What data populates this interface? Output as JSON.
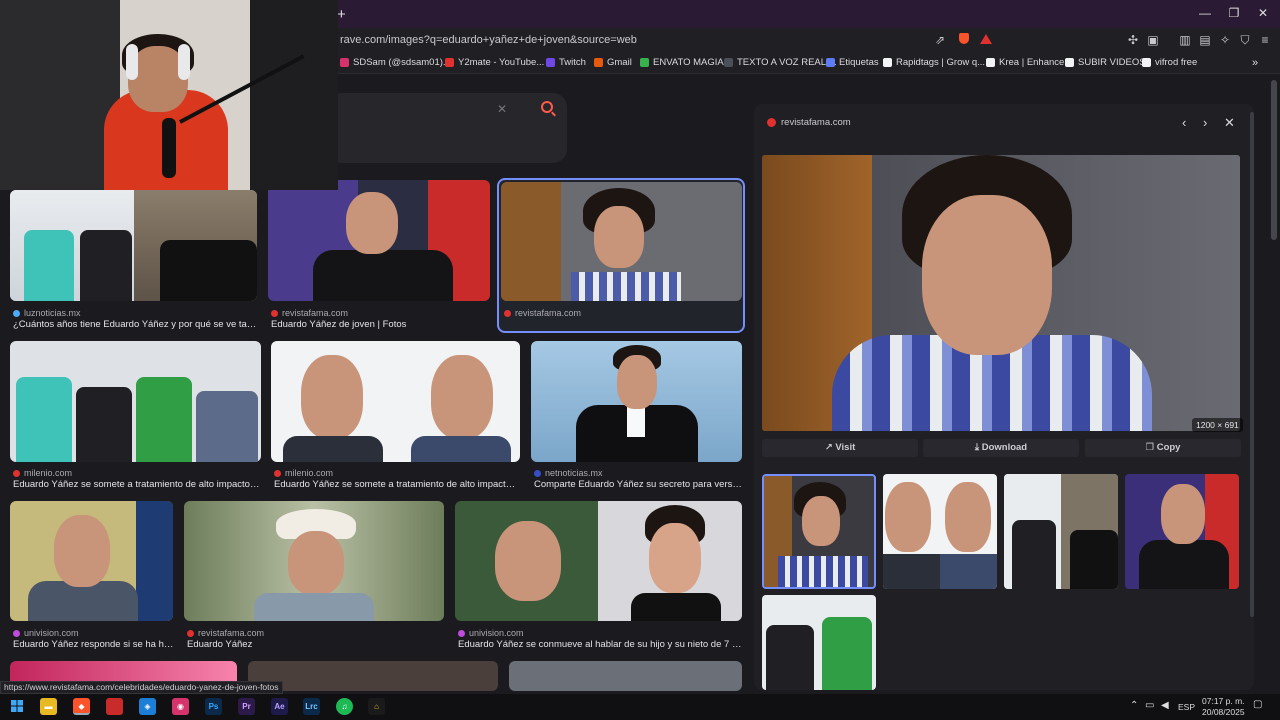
{
  "browser": {
    "url": "rave.com/images?q=eduardo+yañez+de+joven&source=web",
    "new_tab_glyph": "+",
    "window_controls": [
      "—",
      "❐",
      "✕"
    ],
    "bookmarks": [
      {
        "label": "SDSam (@sdsam01)...",
        "color": "#d6336c"
      },
      {
        "label": "Y2mate - YouTube...",
        "color": "#e03131"
      },
      {
        "label": "Twitch",
        "color": "#7048e8"
      },
      {
        "label": "Gmail",
        "color": "#e8590c"
      },
      {
        "label": "ENVATO MAGIA",
        "color": "#37b24d"
      },
      {
        "label": "TEXTO A VOZ REALI...",
        "color": "#495057"
      },
      {
        "label": "Etiquetas",
        "color": "#5c7cfa"
      },
      {
        "label": "Rapidtags | Grow q...",
        "color": "#f1f3f5"
      },
      {
        "label": "Krea | Enhancer",
        "color": "#f1f3f5"
      },
      {
        "label": "SUBIR VIDEOS",
        "color": "#f1f3f5"
      },
      {
        "label": "vifrod free",
        "color": "#f1f3f5"
      }
    ],
    "bookmarks_more": "»"
  },
  "search": {
    "clear_glyph": "✕"
  },
  "results": [
    {
      "source": "luznoticias.mx",
      "caption": "¿Cuántos años tiene Eduardo Yáñez y por qué se ve tan joven?",
      "color": "#4dabf7"
    },
    {
      "source": "revistafama.com",
      "caption": "Eduardo Yáñez de joven | Fotos",
      "color": "#e03131"
    },
    {
      "source": "revistafama.com",
      "caption": "",
      "color": "#e03131"
    },
    {
      "source": "milenio.com",
      "caption": "Eduardo Yáñez se somete a tratamiento de alto impacto para v...",
      "color": "#e03131"
    },
    {
      "source": "milenio.com",
      "caption": "Eduardo Yáñez se somete a tratamiento de alto impacto para v...",
      "color": "#e03131"
    },
    {
      "source": "netnoticias.mx",
      "caption": "Comparte Eduardo Yáñez su secreto para verse joven",
      "color": "#364fc7"
    },
    {
      "source": "univision.com",
      "caption": "Eduardo Yáñez responde si se ha hecho...",
      "color": "#be4bdb"
    },
    {
      "source": "revistafama.com",
      "caption": "Eduardo Yáñez",
      "color": "#e03131"
    },
    {
      "source": "univision.com",
      "caption": "Eduardo Yáñez se conmueve al hablar de su hijo y su nieto de 7 años, a q...",
      "color": "#be4bdb"
    }
  ],
  "panel": {
    "source": "revistafama.com",
    "nav": [
      "‹",
      "›",
      "✕"
    ],
    "dimensions": "1200 × 691",
    "buttons": [
      "Visit",
      "Download",
      "Copy"
    ]
  },
  "status_url": "https://www.revistafama.com/celebridades/eduardo-yanez-de-joven-fotos",
  "taskbar": {
    "apps": [
      {
        "label": "",
        "color": "#0a0a0c"
      },
      {
        "label": "▬",
        "color": "#e8b923"
      },
      {
        "label": "◆",
        "color": "#e8590c"
      },
      {
        "label": "",
        "color": "#c92a2a"
      },
      {
        "label": "◈",
        "color": "#1c7ed6"
      },
      {
        "label": "◉",
        "color": "#d6336c"
      },
      {
        "label": "Ps",
        "color": "#0b2a4a"
      },
      {
        "label": "Pr",
        "color": "#2b1a4a"
      },
      {
        "label": "Ae",
        "color": "#1e1a4a"
      },
      {
        "label": "Lrc",
        "color": "#0b2a4a"
      },
      {
        "label": "♫",
        "color": "#1db954"
      },
      {
        "label": "⌂",
        "color": "#1a1a1a"
      }
    ],
    "language": "ESP",
    "time": "07:17 p. m.",
    "date": "20/08/2025"
  }
}
